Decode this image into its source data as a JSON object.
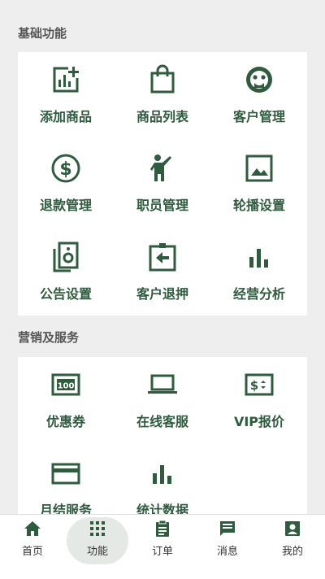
{
  "sections": {
    "basic": {
      "title": "基础功能",
      "items": [
        {
          "label": "添加商品",
          "icon": "add-chart-icon"
        },
        {
          "label": "商品列表",
          "icon": "shopping-bag-icon"
        },
        {
          "label": "客户管理",
          "icon": "face-icon"
        },
        {
          "label": "退款管理",
          "icon": "dollar-circle-icon"
        },
        {
          "label": "职员管理",
          "icon": "person-wave-icon"
        },
        {
          "label": "轮播设置",
          "icon": "image-icon"
        },
        {
          "label": "公告设置",
          "icon": "speaker-icon"
        },
        {
          "label": "客户退押",
          "icon": "return-clipboard-icon"
        },
        {
          "label": "经营分析",
          "icon": "bar-chart-icon"
        }
      ]
    },
    "marketing": {
      "title": "营销及服务",
      "items": [
        {
          "label": "优惠券",
          "icon": "coupon-100-icon"
        },
        {
          "label": "在线客服",
          "icon": "laptop-icon"
        },
        {
          "label": "VIP报价",
          "icon": "price-tag-icon"
        },
        {
          "label": "月结服务",
          "icon": "credit-card-icon"
        },
        {
          "label": "统计数据",
          "icon": "bar-chart-icon"
        }
      ]
    }
  },
  "tabbar": {
    "tabs": [
      {
        "label": "首页",
        "icon": "home-icon"
      },
      {
        "label": "功能",
        "icon": "apps-grid-icon",
        "active": true
      },
      {
        "label": "订单",
        "icon": "clipboard-icon"
      },
      {
        "label": "消息",
        "icon": "message-icon"
      },
      {
        "label": "我的",
        "icon": "account-box-icon"
      }
    ]
  },
  "colors": {
    "accent": "#2f5b3e",
    "background": "#eeeeee",
    "card": "#ffffff"
  }
}
